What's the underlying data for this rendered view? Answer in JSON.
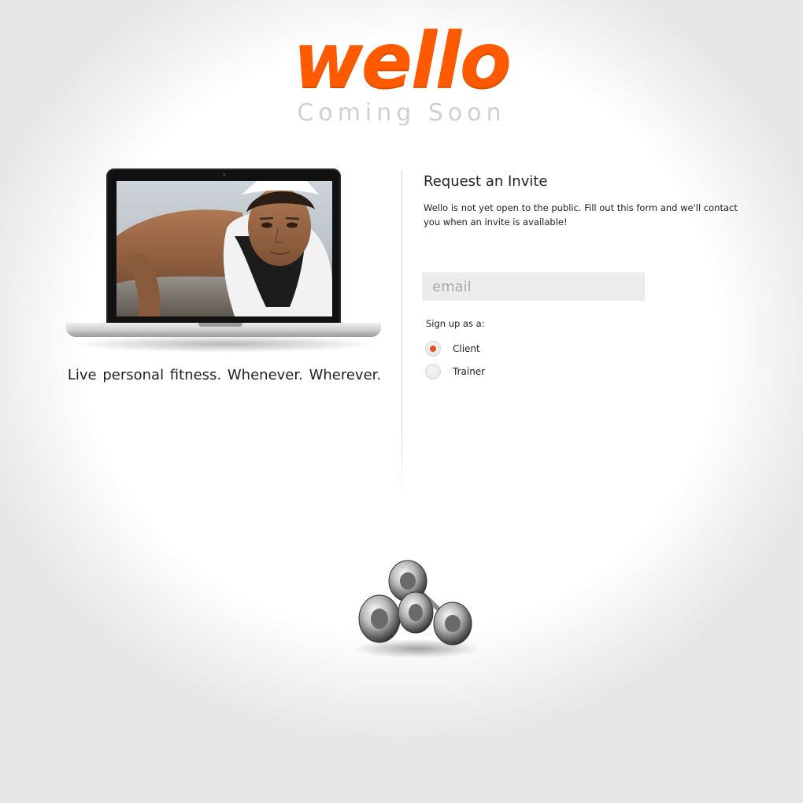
{
  "header": {
    "logo_text": "wello",
    "subtitle": "Coming Soon"
  },
  "hero": {
    "tagline": "Live personal fitness.  Whenever.  Wherever."
  },
  "invite_form": {
    "title": "Request an Invite",
    "description": "Wello is not yet open to the public.  Fill out this form and we'll contact you when an invite is available!",
    "email_placeholder": "email",
    "email_value": "",
    "signup_label": "Sign up as a:",
    "options": [
      {
        "label": "Client",
        "selected": true
      },
      {
        "label": "Trainer",
        "selected": false
      }
    ]
  },
  "colors": {
    "brand": "#ff5a00",
    "radio_selected": "#e0521a",
    "subtitle": "#d0d0d0"
  },
  "images": {
    "laptop_screen": "woman-doing-pushup-photo",
    "footer": "dumbbells-image"
  }
}
